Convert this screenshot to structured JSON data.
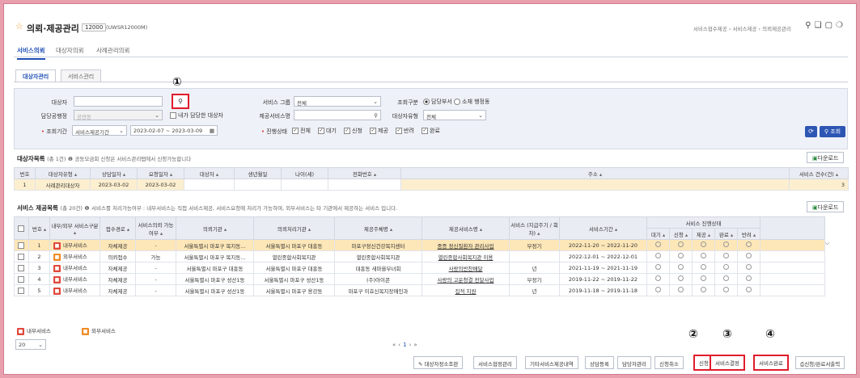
{
  "header": {
    "title": "의뢰·제공관리",
    "code": "12000",
    "screen_id": "(UWSR12000M)",
    "breadcrumb": "서비스협수제공 › 서비스제공 › 의뢰제공관리",
    "icons": [
      "pin-icon",
      "bookmark-icon",
      "window-icon",
      "help-icon"
    ]
  },
  "main_tabs": [
    "서비스의뢰",
    "대상자의뢰",
    "사례관리의뢰"
  ],
  "sub_tabs": [
    "대상자관리",
    "서비스관리"
  ],
  "search": {
    "target_label": "대상자",
    "target_value": "",
    "manager_label": "담당공행정",
    "manager_value": "공연동",
    "my_target_label": "내가 담당한 대상자",
    "period_label": "조회기간",
    "period_type": "서비스제공기간",
    "period_range": "2023-02-07 ~ 2023-03-09",
    "service_group_label": "서비스 그룹",
    "service_group_value": "전체",
    "provide_service_label": "제공서비스명",
    "provide_service_value": "",
    "progress_label": "진행상태",
    "progress_options": [
      "전체",
      "대기",
      "신청",
      "제공",
      "반려",
      "완료"
    ],
    "query_type_label": "조회구분",
    "query_type_options": [
      "담당부서",
      "소재 행정동"
    ],
    "target_type_label": "대상자유형",
    "target_type_value": "전체",
    "search_button": "조회"
  },
  "target_list": {
    "title": "대상자목록",
    "count": "(총 1건)",
    "note": "공동모금회 신청은 서비스관리탭에서 신청가능합니다",
    "download": "다운로드",
    "columns": [
      "번호",
      "대상자유형",
      "상담일자",
      "요청일자",
      "대상자",
      "생년월일",
      "나이(세)",
      "전화번호",
      "주소",
      "서비스 건수(건)"
    ],
    "rows": [
      [
        "1",
        "사례관리대상자",
        "2023-03-02",
        "2023-03-02",
        "",
        "",
        "",
        "",
        "",
        "3"
      ]
    ]
  },
  "service_list": {
    "title": "서비스 제공목록",
    "count": "(총 20건)",
    "note": "서비스를 처리가능여부 : 내부서비스는 직접 서비스제공, 서비스요청에 처리가 가능하며, 외부서비스는 타 기관에서 제공하는 서비스 입니다.",
    "download": "다운로드",
    "columns": [
      "번호",
      "내부/외부 서비스구분",
      "접수경로",
      "서비스의뢰 가능여부",
      "의뢰기관",
      "의뢰처리기관",
      "제공주체명",
      "제공서비스명",
      "서비스 (지급주기 / 회차)",
      "서비스기간"
    ],
    "status_header": "서비스 진행상태",
    "status_columns": [
      "대기",
      "신청",
      "제공",
      "완료",
      "반려"
    ],
    "rows": [
      {
        "no": "1",
        "kind": "내부서비스",
        "kind_type": "in",
        "route": "자체제공",
        "possible": "-",
        "req_org": "서울특별시 마포구 복지동...",
        "proc_org": "서울특별시 마포구 대흥동",
        "provider": "마포구정신건강복지센터",
        "service": "중증 정신질환자 관리사업",
        "cycle": "부정기",
        "period": "2022-11-20 ~ 2022-11-20"
      },
      {
        "no": "2",
        "kind": "외부서비스",
        "kind_type": "out",
        "route": "의뢰접수",
        "possible": "가능",
        "req_org": "서울특별시 마포구 복지동...",
        "proc_org": "열린종합사회복지관",
        "provider": "열린종합사회복지관",
        "service": "열린종합사회복지관 이용",
        "cycle": "",
        "period": "2022-12-01 ~ 2022-12-01"
      },
      {
        "no": "3",
        "kind": "내부서비스",
        "kind_type": "in",
        "route": "자체제공",
        "possible": "-",
        "req_org": "서울특별시 마포구 대흥동",
        "proc_org": "서울특별시 마포구 대흥동",
        "provider": "대흥동 새마을부녀회",
        "service": "사랑의반찬배달",
        "cycle": "년",
        "period": "2021-11-19 ~ 2021-11-19"
      },
      {
        "no": "4",
        "kind": "내부서비스",
        "kind_type": "in",
        "route": "자체제공",
        "possible": "-",
        "req_org": "서울특별시 마포구 성산1동",
        "proc_org": "서울특별시 마포구 성산1동",
        "provider": "(주)아이콘",
        "service": "사랑의 고운청결 전달사업",
        "cycle": "부정기",
        "period": "2019-11-22 ~ 2019-11-22"
      },
      {
        "no": "5",
        "kind": "내부서비스",
        "kind_type": "in",
        "route": "자체제공",
        "possible": "-",
        "req_org": "서울특별시 마포구 성산1동",
        "proc_org": "서울특별시 마포구 용강동",
        "provider": "마포구 이효신복지장애인과",
        "service": "집적 지원",
        "cycle": "년",
        "period": "2019-11-18 ~ 2019-11-18"
      }
    ]
  },
  "legend": {
    "internal": "내부서비스",
    "external": "외부서비스"
  },
  "page_size": "20",
  "pager": {
    "current": "1"
  },
  "bottom_buttons": [
    "대상자정소조판",
    "서비스협정관리",
    "기타서비스제공내역",
    "상담등록",
    "담당자관리",
    "신청취소",
    "신청",
    "서비스결정",
    "서비스완료",
    "신청/완료서출력"
  ],
  "annotations": [
    "①",
    "②",
    "③",
    "④"
  ]
}
